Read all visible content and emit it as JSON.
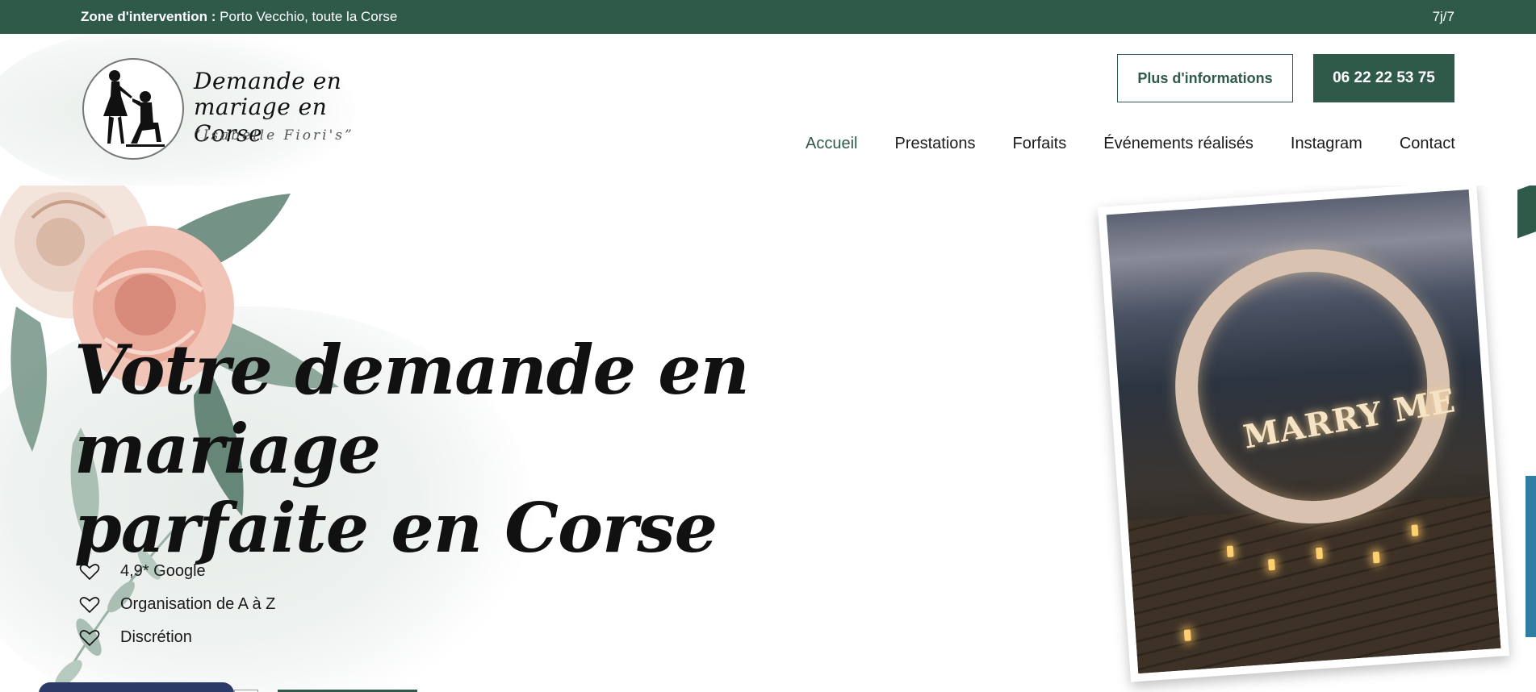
{
  "topbar": {
    "zone_label": "Zone d'intervention :",
    "zone_value": "Porto Vecchio, toute la Corse",
    "hours": "7j/7"
  },
  "logo": {
    "line1": "Demande en",
    "line2": "mariage en Corse",
    "line3": "“Isabelle Fiori's”",
    "icon": "proposal-silhouette-icon"
  },
  "header": {
    "info_button": "Plus d'informations",
    "phone_button": "06 22 22 53 75"
  },
  "nav": {
    "items": [
      {
        "label": "Accueil",
        "active": true
      },
      {
        "label": "Prestations"
      },
      {
        "label": "Forfaits"
      },
      {
        "label": "Événements réalisés"
      },
      {
        "label": "Instagram"
      },
      {
        "label": "Contact"
      }
    ]
  },
  "hero": {
    "title_line1": "Votre demande en mariage",
    "title_line2": "parfaite en Corse",
    "features": [
      {
        "icon": "heart-icon",
        "label": "4,9* Google"
      },
      {
        "icon": "heart-icon",
        "label": "Organisation de A à Z"
      },
      {
        "icon": "heart-icon",
        "label": "Discrétion"
      }
    ],
    "photo_sign": "MARRY ME"
  },
  "colors": {
    "brand_green": "#2f5a4a",
    "cta_navy": "#2b3a67",
    "text": "#1a1a1a"
  }
}
